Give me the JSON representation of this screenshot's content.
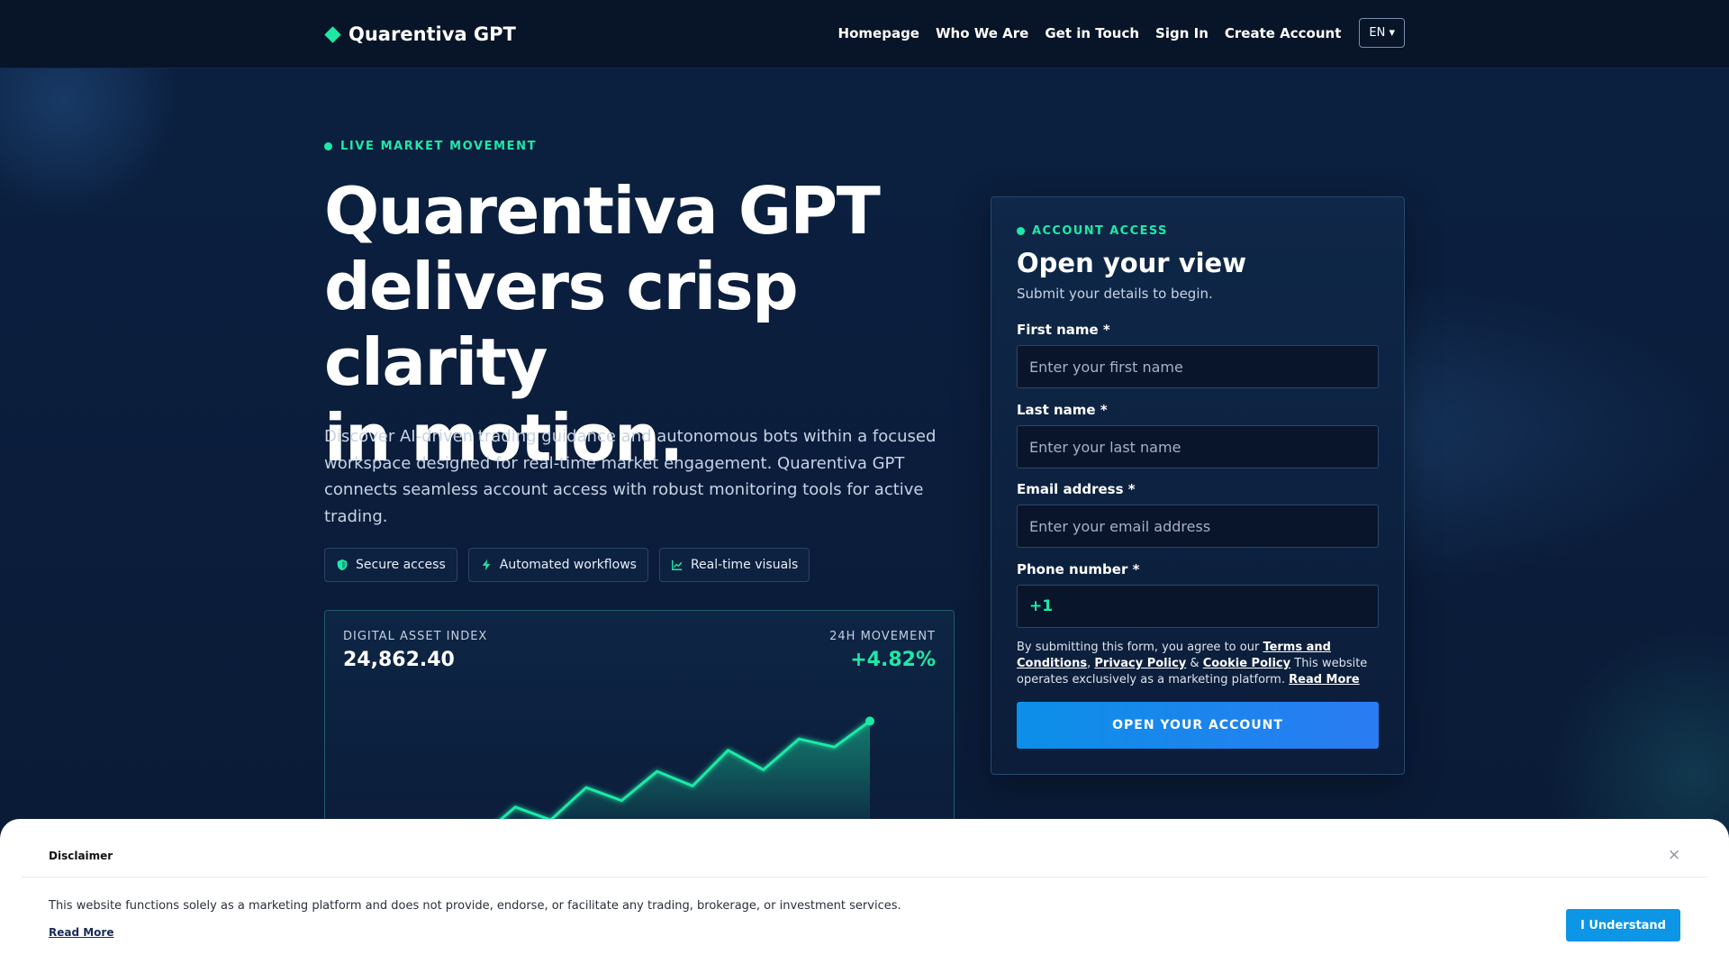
{
  "brand": {
    "name": "Quarentiva GPT",
    "accent": "#1de9a6"
  },
  "nav": {
    "items": [
      "Homepage",
      "Who We Are",
      "Get in Touch",
      "Sign In",
      "Create Account"
    ],
    "language": "EN ▾"
  },
  "hero": {
    "eyebrow": "LIVE MARKET MOVEMENT",
    "headline_lines": [
      "Quarentiva GPT",
      "delivers crisp clarity",
      "in motion."
    ],
    "lead": "Discover AI-driven trading guidance and autonomous bots within a focused workspace designed for real-time market engagement. Quarentiva GPT connects seamless account access with robust monitoring tools for active trading.",
    "pills": [
      {
        "label": "Secure access",
        "icon": "shield-icon"
      },
      {
        "label": "Automated workflows",
        "icon": "lightning-icon"
      },
      {
        "label": "Real-time visuals",
        "icon": "line-chart-icon"
      }
    ]
  },
  "market_card": {
    "left_label": "DIGITAL ASSET INDEX",
    "left_value": "24,862.40",
    "right_label": "24H MOVEMENT",
    "right_value": "+4.82%",
    "line_color": "#1de9a6"
  },
  "chart_data": {
    "type": "area",
    "title": "",
    "xlabel": "",
    "ylabel": "",
    "x": [
      1,
      2,
      3,
      4,
      5,
      6,
      7,
      8,
      9,
      10,
      11,
      12,
      13,
      14
    ],
    "values": [
      5,
      13,
      10,
      29,
      21,
      41,
      33,
      51,
      42,
      64,
      52,
      71,
      66,
      82
    ],
    "ylim": [
      0,
      100
    ],
    "grid": false
  },
  "form": {
    "eyebrow": "ACCOUNT ACCESS",
    "title": "Open your view",
    "subtitle": "Submit your details to begin.",
    "first_name": {
      "label": "First name *",
      "placeholder": "Enter your first name",
      "value": ""
    },
    "last_name": {
      "label": "Last name *",
      "placeholder": "Enter your last name",
      "value": ""
    },
    "email": {
      "label": "Email address *",
      "placeholder": "Enter your email address",
      "value": ""
    },
    "phone": {
      "label": "Phone number *",
      "code": "+1",
      "value": ""
    },
    "consent": {
      "prefix": "By submitting this form, you agree to our",
      "terms": "Terms and Conditions",
      "sep1": ",",
      "privacy": "Privacy Policy",
      "amp": "&",
      "cookie": "Cookie Policy",
      "suffix": "This website operates exclusively as a marketing platform.",
      "read_more": "Read More"
    },
    "submit": "OPEN YOUR ACCOUNT",
    "button_color": "#0c8fe8"
  },
  "disclaimer": {
    "title": "Disclaimer",
    "text": "This website functions solely as a marketing platform and does not provide, endorse, or facilitate any trading, brokerage, or investment services.",
    "read_more": "Read More",
    "button": "I Understand",
    "close": "×"
  }
}
